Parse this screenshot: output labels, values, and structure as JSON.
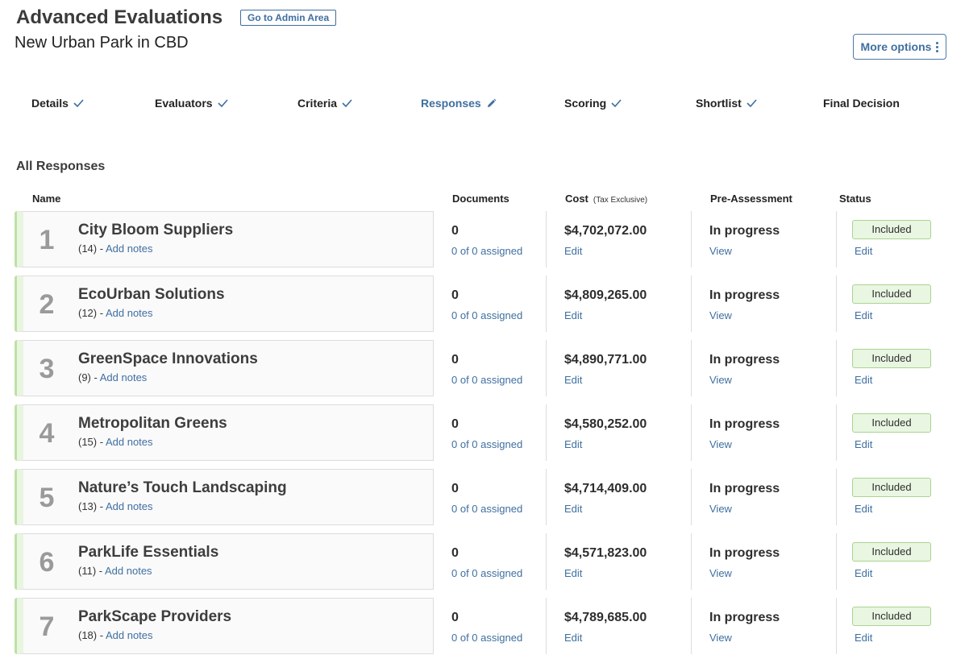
{
  "header": {
    "app_title": "Advanced Evaluations",
    "admin_button": "Go to Admin Area",
    "project_title": "New Urban Park in CBD",
    "more_options": "More options"
  },
  "steps": [
    {
      "label": "Details",
      "state": "complete"
    },
    {
      "label": "Evaluators",
      "state": "complete"
    },
    {
      "label": "Criteria",
      "state": "complete"
    },
    {
      "label": "Responses",
      "state": "editing"
    },
    {
      "label": "Scoring",
      "state": "complete"
    },
    {
      "label": "Shortlist",
      "state": "complete"
    },
    {
      "label": "Final Decision",
      "state": "none"
    }
  ],
  "section_title": "All Responses",
  "columns": {
    "name": "Name",
    "documents": "Documents",
    "cost": "Cost",
    "cost_note": "(Tax Exclusive)",
    "pre_assessment": "Pre-Assessment",
    "status": "Status"
  },
  "responses": [
    {
      "rank": "1",
      "name": "City Bloom Suppliers",
      "count": "(14) -",
      "notes_link": "Add notes",
      "documents": "0",
      "assigned": "0 of 0 assigned",
      "cost": "$4,702,072.00",
      "cost_edit": "Edit",
      "pre_assessment": "In progress",
      "pre_view": "View",
      "status": "Included",
      "status_edit": "Edit"
    },
    {
      "rank": "2",
      "name": "EcoUrban Solutions",
      "count": "(12) -",
      "notes_link": "Add notes",
      "documents": "0",
      "assigned": "0 of 0 assigned",
      "cost": "$4,809,265.00",
      "cost_edit": "Edit",
      "pre_assessment": "In progress",
      "pre_view": "View",
      "status": "Included",
      "status_edit": "Edit"
    },
    {
      "rank": "3",
      "name": "GreenSpace Innovations",
      "count": "(9) -",
      "notes_link": "Add notes",
      "documents": "0",
      "assigned": "0 of 0 assigned",
      "cost": "$4,890,771.00",
      "cost_edit": "Edit",
      "pre_assessment": "In progress",
      "pre_view": "View",
      "status": "Included",
      "status_edit": "Edit"
    },
    {
      "rank": "4",
      "name": "Metropolitan Greens",
      "count": "(15) -",
      "notes_link": "Add notes",
      "documents": "0",
      "assigned": "0 of 0 assigned",
      "cost": "$4,580,252.00",
      "cost_edit": "Edit",
      "pre_assessment": "In progress",
      "pre_view": "View",
      "status": "Included",
      "status_edit": "Edit"
    },
    {
      "rank": "5",
      "name": "Nature’s Touch Landscaping",
      "count": "(13) -",
      "notes_link": "Add notes",
      "documents": "0",
      "assigned": "0 of 0 assigned",
      "cost": "$4,714,409.00",
      "cost_edit": "Edit",
      "pre_assessment": "In progress",
      "pre_view": "View",
      "status": "Included",
      "status_edit": "Edit"
    },
    {
      "rank": "6",
      "name": "ParkLife Essentials",
      "count": "(11) -",
      "notes_link": "Add notes",
      "documents": "0",
      "assigned": "0 of 0 assigned",
      "cost": "$4,571,823.00",
      "cost_edit": "Edit",
      "pre_assessment": "In progress",
      "pre_view": "View",
      "status": "Included",
      "status_edit": "Edit"
    },
    {
      "rank": "7",
      "name": "ParkScape Providers",
      "count": "(18) -",
      "notes_link": "Add notes",
      "documents": "0",
      "assigned": "0 of 0 assigned",
      "cost": "$4,789,685.00",
      "cost_edit": "Edit",
      "pre_assessment": "In progress",
      "pre_view": "View",
      "status": "Included",
      "status_edit": "Edit"
    }
  ],
  "colors": {
    "accent": "#3f6fa0",
    "included_bg": "#e9f6e2",
    "included_border": "#a9d48f"
  }
}
